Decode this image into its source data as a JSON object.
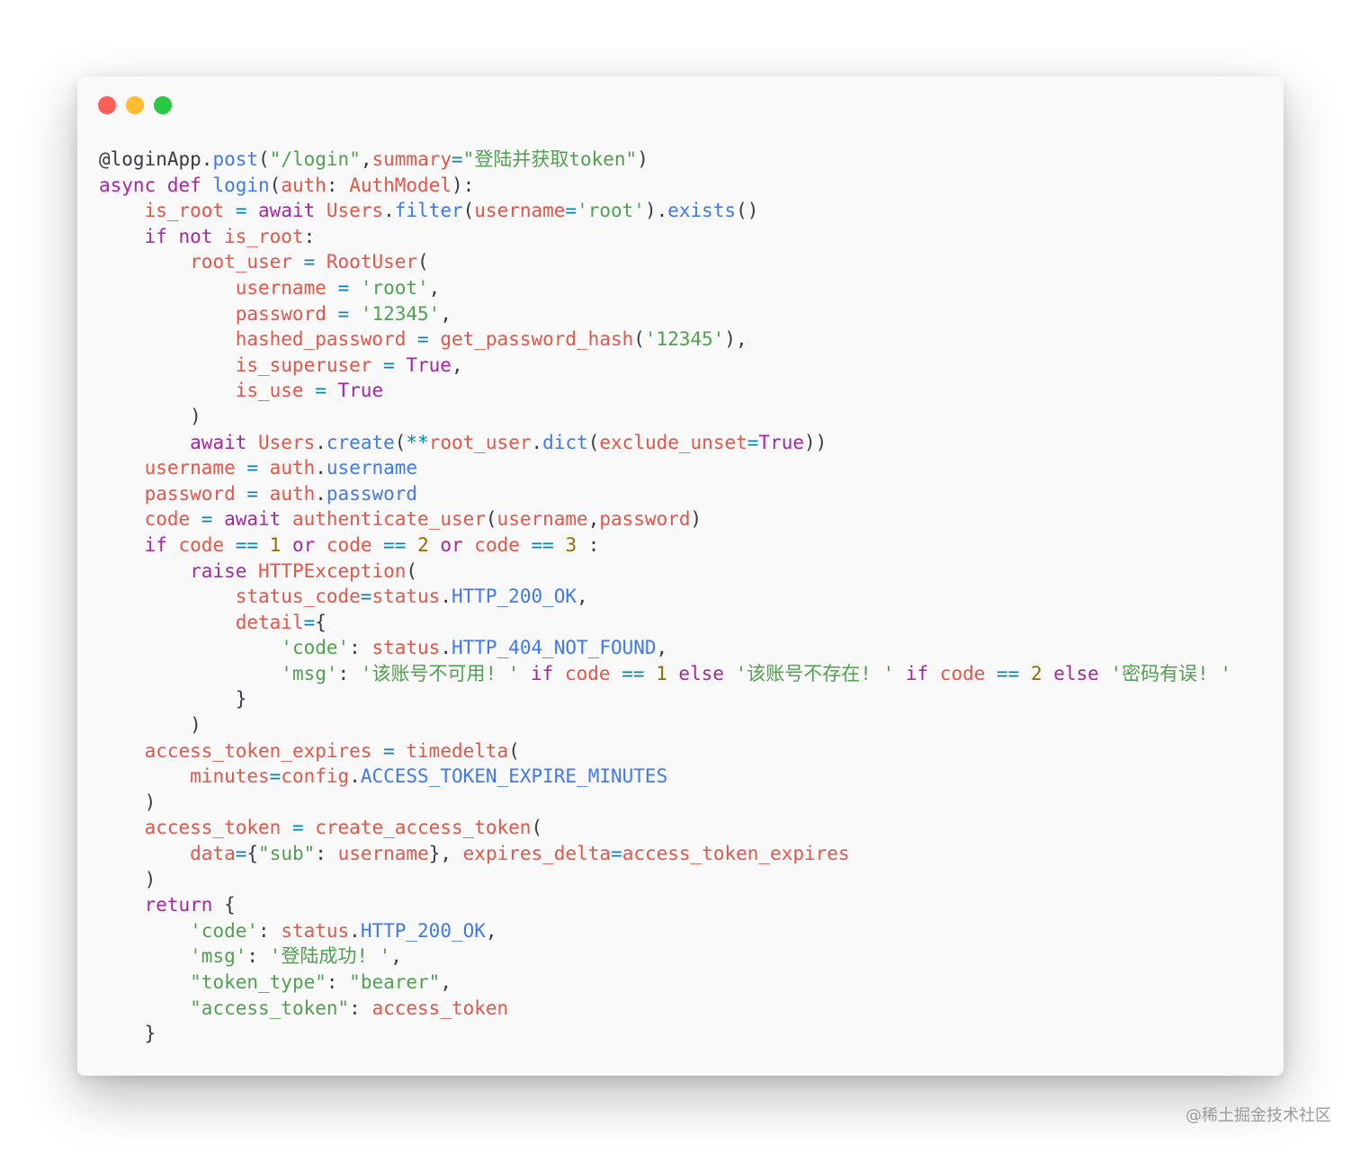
{
  "window": {
    "controls": [
      {
        "name": "close",
        "color": "#ff5f57"
      },
      {
        "name": "minimize",
        "color": "#febc2e"
      },
      {
        "name": "zoom",
        "color": "#28c840"
      }
    ]
  },
  "colors": {
    "keyword": "#a626a4",
    "variable": "#e45649",
    "string": "#50a14f",
    "attribute": "#4078f2",
    "number": "#986801",
    "operator": "#0184bc",
    "plain": "#383a42",
    "background": "#f9f9f9"
  },
  "code": [
    [
      [
        "deco",
        "@loginApp"
      ],
      [
        "plain",
        "."
      ],
      [
        "attr",
        "post"
      ],
      [
        "plain",
        "("
      ],
      [
        "str",
        "\"/login\""
      ],
      [
        "plain",
        ","
      ],
      [
        "var",
        "summary"
      ],
      [
        "op",
        "="
      ],
      [
        "str",
        "\"登陆并获取token\""
      ],
      [
        "plain",
        ")"
      ]
    ],
    [
      [
        "kw",
        "async def "
      ],
      [
        "attr",
        "login"
      ],
      [
        "plain",
        "("
      ],
      [
        "var",
        "auth"
      ],
      [
        "plain",
        ": "
      ],
      [
        "var",
        "AuthModel"
      ],
      [
        "plain",
        "):"
      ]
    ],
    [
      [
        "plain",
        "    "
      ],
      [
        "var",
        "is_root"
      ],
      [
        "op",
        " = "
      ],
      [
        "kw",
        "await "
      ],
      [
        "var",
        "Users"
      ],
      [
        "plain",
        "."
      ],
      [
        "attr",
        "filter"
      ],
      [
        "plain",
        "("
      ],
      [
        "var",
        "username"
      ],
      [
        "op",
        "="
      ],
      [
        "str",
        "'root'"
      ],
      [
        "plain",
        ")."
      ],
      [
        "attr",
        "exists"
      ],
      [
        "plain",
        "()"
      ]
    ],
    [
      [
        "plain",
        "    "
      ],
      [
        "kw",
        "if not "
      ],
      [
        "var",
        "is_root"
      ],
      [
        "plain",
        ":"
      ]
    ],
    [
      [
        "plain",
        "        "
      ],
      [
        "var",
        "root_user"
      ],
      [
        "op",
        " = "
      ],
      [
        "var",
        "RootUser"
      ],
      [
        "plain",
        "("
      ]
    ],
    [
      [
        "plain",
        "            "
      ],
      [
        "var",
        "username"
      ],
      [
        "op",
        " = "
      ],
      [
        "str",
        "'root'"
      ],
      [
        "plain",
        ","
      ]
    ],
    [
      [
        "plain",
        "            "
      ],
      [
        "var",
        "password"
      ],
      [
        "op",
        " = "
      ],
      [
        "str",
        "'12345'"
      ],
      [
        "plain",
        ","
      ]
    ],
    [
      [
        "plain",
        "            "
      ],
      [
        "var",
        "hashed_password"
      ],
      [
        "op",
        " = "
      ],
      [
        "var",
        "get_password_hash"
      ],
      [
        "plain",
        "("
      ],
      [
        "str",
        "'12345'"
      ],
      [
        "plain",
        "),"
      ]
    ],
    [
      [
        "plain",
        "            "
      ],
      [
        "var",
        "is_superuser"
      ],
      [
        "op",
        " = "
      ],
      [
        "kw",
        "True"
      ],
      [
        "plain",
        ","
      ]
    ],
    [
      [
        "plain",
        "            "
      ],
      [
        "var",
        "is_use"
      ],
      [
        "op",
        " = "
      ],
      [
        "kw",
        "True"
      ]
    ],
    [
      [
        "plain",
        "        )"
      ]
    ],
    [
      [
        "plain",
        "        "
      ],
      [
        "kw",
        "await "
      ],
      [
        "var",
        "Users"
      ],
      [
        "plain",
        "."
      ],
      [
        "attr",
        "create"
      ],
      [
        "plain",
        "("
      ],
      [
        "op",
        "**"
      ],
      [
        "var",
        "root_user"
      ],
      [
        "plain",
        "."
      ],
      [
        "attr",
        "dict"
      ],
      [
        "plain",
        "("
      ],
      [
        "var",
        "exclude_unset"
      ],
      [
        "op",
        "="
      ],
      [
        "kw",
        "True"
      ],
      [
        "plain",
        "))"
      ]
    ],
    [
      [
        "plain",
        "    "
      ],
      [
        "var",
        "username"
      ],
      [
        "op",
        " = "
      ],
      [
        "var",
        "auth"
      ],
      [
        "plain",
        "."
      ],
      [
        "attr",
        "username"
      ]
    ],
    [
      [
        "plain",
        "    "
      ],
      [
        "var",
        "password"
      ],
      [
        "op",
        " = "
      ],
      [
        "var",
        "auth"
      ],
      [
        "plain",
        "."
      ],
      [
        "attr",
        "password"
      ]
    ],
    [
      [
        "plain",
        "    "
      ],
      [
        "var",
        "code"
      ],
      [
        "op",
        " = "
      ],
      [
        "kw",
        "await "
      ],
      [
        "var",
        "authenticate_user"
      ],
      [
        "plain",
        "("
      ],
      [
        "var",
        "username"
      ],
      [
        "plain",
        ","
      ],
      [
        "var",
        "password"
      ],
      [
        "plain",
        ")"
      ]
    ],
    [
      [
        "plain",
        "    "
      ],
      [
        "kw",
        "if "
      ],
      [
        "var",
        "code"
      ],
      [
        "op",
        " == "
      ],
      [
        "num",
        "1"
      ],
      [
        "kw",
        " or "
      ],
      [
        "var",
        "code"
      ],
      [
        "op",
        " == "
      ],
      [
        "num",
        "2"
      ],
      [
        "kw",
        " or "
      ],
      [
        "var",
        "code"
      ],
      [
        "op",
        " == "
      ],
      [
        "num",
        "3"
      ],
      [
        "plain",
        " :"
      ]
    ],
    [
      [
        "plain",
        "        "
      ],
      [
        "kw",
        "raise "
      ],
      [
        "var",
        "HTTPException"
      ],
      [
        "plain",
        "("
      ]
    ],
    [
      [
        "plain",
        "            "
      ],
      [
        "var",
        "status_code"
      ],
      [
        "op",
        "="
      ],
      [
        "var",
        "status"
      ],
      [
        "plain",
        "."
      ],
      [
        "attr",
        "HTTP_200_OK"
      ],
      [
        "plain",
        ","
      ]
    ],
    [
      [
        "plain",
        "            "
      ],
      [
        "var",
        "detail"
      ],
      [
        "op",
        "="
      ],
      [
        "plain",
        "{"
      ]
    ],
    [
      [
        "plain",
        "                "
      ],
      [
        "str",
        "'code'"
      ],
      [
        "plain",
        ": "
      ],
      [
        "var",
        "status"
      ],
      [
        "plain",
        "."
      ],
      [
        "attr",
        "HTTP_404_NOT_FOUND"
      ],
      [
        "plain",
        ","
      ]
    ],
    [
      [
        "plain",
        "                "
      ],
      [
        "str",
        "'msg'"
      ],
      [
        "plain",
        ": "
      ],
      [
        "str",
        "'该账号不可用! '"
      ],
      [
        "kw",
        " if "
      ],
      [
        "var",
        "code"
      ],
      [
        "op",
        " == "
      ],
      [
        "num",
        "1"
      ],
      [
        "kw",
        " else "
      ],
      [
        "str",
        "'该账号不存在! '"
      ],
      [
        "kw",
        " if "
      ],
      [
        "var",
        "code"
      ],
      [
        "op",
        " == "
      ],
      [
        "num",
        "2"
      ],
      [
        "kw",
        " else "
      ],
      [
        "str",
        "'密码有误! '"
      ]
    ],
    [
      [
        "plain",
        "            }"
      ]
    ],
    [
      [
        "plain",
        "        )"
      ]
    ],
    [
      [
        "plain",
        "    "
      ],
      [
        "var",
        "access_token_expires"
      ],
      [
        "op",
        " = "
      ],
      [
        "var",
        "timedelta"
      ],
      [
        "plain",
        "("
      ]
    ],
    [
      [
        "plain",
        "        "
      ],
      [
        "var",
        "minutes"
      ],
      [
        "op",
        "="
      ],
      [
        "var",
        "config"
      ],
      [
        "plain",
        "."
      ],
      [
        "attr",
        "ACCESS_TOKEN_EXPIRE_MINUTES"
      ]
    ],
    [
      [
        "plain",
        "    )"
      ]
    ],
    [
      [
        "plain",
        "    "
      ],
      [
        "var",
        "access_token"
      ],
      [
        "op",
        " = "
      ],
      [
        "var",
        "create_access_token"
      ],
      [
        "plain",
        "("
      ]
    ],
    [
      [
        "plain",
        "        "
      ],
      [
        "var",
        "data"
      ],
      [
        "op",
        "="
      ],
      [
        "plain",
        "{"
      ],
      [
        "str",
        "\"sub\""
      ],
      [
        "plain",
        ": "
      ],
      [
        "var",
        "username"
      ],
      [
        "plain",
        "}, "
      ],
      [
        "var",
        "expires_delta"
      ],
      [
        "op",
        "="
      ],
      [
        "var",
        "access_token_expires"
      ]
    ],
    [
      [
        "plain",
        "    )"
      ]
    ],
    [
      [
        "plain",
        "    "
      ],
      [
        "kw",
        "return "
      ],
      [
        "plain",
        "{"
      ]
    ],
    [
      [
        "plain",
        "        "
      ],
      [
        "str",
        "'code'"
      ],
      [
        "plain",
        ": "
      ],
      [
        "var",
        "status"
      ],
      [
        "plain",
        "."
      ],
      [
        "attr",
        "HTTP_200_OK"
      ],
      [
        "plain",
        ","
      ]
    ],
    [
      [
        "plain",
        "        "
      ],
      [
        "str",
        "'msg'"
      ],
      [
        "plain",
        ": "
      ],
      [
        "str",
        "'登陆成功! '"
      ],
      [
        "plain",
        ","
      ]
    ],
    [
      [
        "plain",
        "        "
      ],
      [
        "str",
        "\"token_type\""
      ],
      [
        "plain",
        ": "
      ],
      [
        "str",
        "\"bearer\""
      ],
      [
        "plain",
        ","
      ]
    ],
    [
      [
        "plain",
        "        "
      ],
      [
        "str",
        "\"access_token\""
      ],
      [
        "plain",
        ": "
      ],
      [
        "var",
        "access_token"
      ]
    ],
    [
      [
        "plain",
        "    }"
      ]
    ]
  ],
  "watermark": "@稀土掘金技术社区"
}
